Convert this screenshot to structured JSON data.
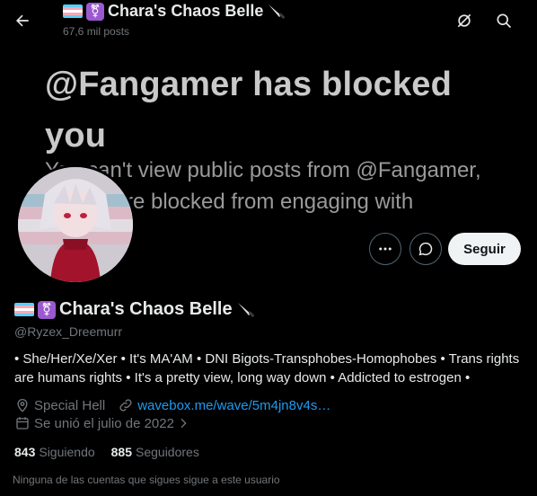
{
  "banner": {
    "headline_line1": "@Fangamer has blocked",
    "headline_line2": "you",
    "sub_line1": "You can't view public posts from @Fangamer,",
    "sub_line2": "and you're blocked from engaging with"
  },
  "topbar": {
    "title": "Chara's Chaos Belle",
    "post_count": "67,6 mil posts",
    "back_icon": "arrow-left-icon",
    "grok_icon": "grok-icon",
    "search_icon": "search-icon"
  },
  "profile": {
    "name": "Chara's Chaos Belle",
    "handle": "@Ryzex_Dreemurr",
    "bio": "• She/Her/Xe/Xer • It's MA'AM • DNI Bigots-Transphobes-Homophobes • Trans rights are humans rights • It's a pretty view, long way down • Addicted to estrogen •",
    "location": "Special Hell",
    "website": "wavebox.me/wave/5m4jn8v4s…",
    "joined": "Se unió el julio de 2022",
    "following_count": "843",
    "following_label": "Siguiendo",
    "followers_count": "885",
    "followers_label": "Seguidores",
    "mutuals_note": "Ninguna de las cuentas que sigues sigue a este usuario"
  },
  "actions": {
    "follow_label": "Seguir",
    "more_icon": "more-icon",
    "message_icon": "message-icon"
  },
  "colors": {
    "background": "#000000",
    "text": "#e7e9ea",
    "muted": "#71767b",
    "link": "#1d9bf0",
    "follow_bg": "#eff3f4"
  }
}
